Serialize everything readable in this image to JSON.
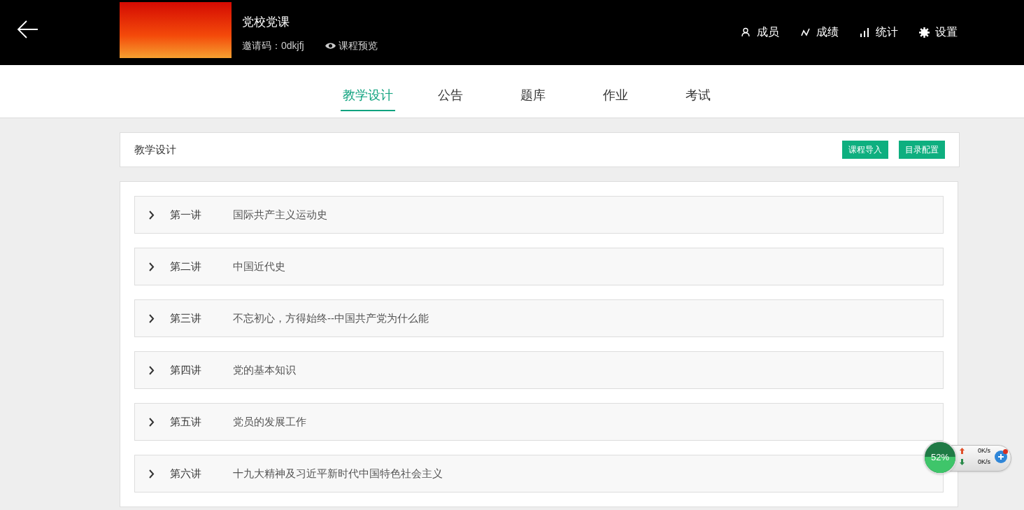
{
  "header": {
    "title": "党校党课",
    "invite_code": "邀请码：0dkjfj",
    "preview_link": "课程预览",
    "nav": [
      {
        "kind": "members",
        "label": "成员"
      },
      {
        "kind": "grades",
        "label": "成绩"
      },
      {
        "kind": "stats",
        "label": "统计"
      },
      {
        "kind": "settings",
        "label": "设置"
      }
    ]
  },
  "tabs": [
    {
      "label": "教学设计",
      "selected": true
    },
    {
      "label": "公告",
      "selected": false
    },
    {
      "label": "题库",
      "selected": false
    },
    {
      "label": "作业",
      "selected": false
    },
    {
      "label": "考试",
      "selected": false
    }
  ],
  "section": {
    "title": "教学设计",
    "buttons": [
      "课程导入",
      "目录配置"
    ]
  },
  "lessons": [
    {
      "number": "第一讲",
      "title": "国际共产主义运动史",
      "expanded": false
    },
    {
      "number": "第二讲",
      "title": "中国近代史",
      "expanded": false
    },
    {
      "number": "第三讲",
      "title": "不忘初心，方得始终--中国共产党为什么能",
      "expanded": false
    },
    {
      "number": "第四讲",
      "title": "党的基本知识",
      "expanded": false
    },
    {
      "number": "第五讲",
      "title": "党员的发展工作",
      "expanded": false
    },
    {
      "number": "第六讲",
      "title": "十九大精神及习近平新时代中国特色社会主义",
      "expanded": false
    }
  ],
  "speed_widget": {
    "percent": "52%",
    "level": 0.52,
    "upload": "0K/s",
    "download": "0K/s"
  }
}
